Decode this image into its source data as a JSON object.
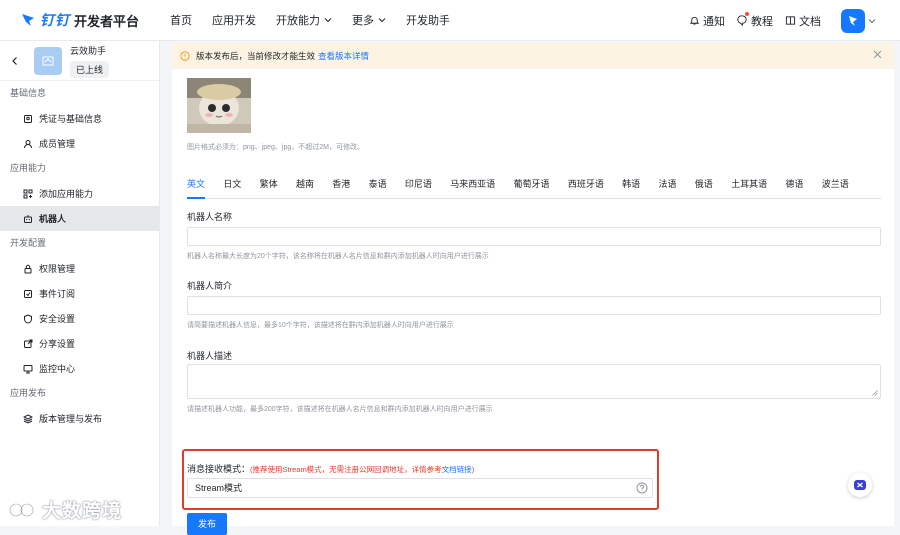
{
  "topbar": {
    "brand": "钉钉",
    "title": "开发者平台",
    "nav": [
      {
        "label": "首页",
        "has_menu": false
      },
      {
        "label": "应用开发",
        "has_menu": false
      },
      {
        "label": "开放能力",
        "has_menu": true
      },
      {
        "label": "更多",
        "has_menu": true
      },
      {
        "label": "开发助手",
        "has_menu": false
      }
    ],
    "notify": "通知",
    "tutorial": "教程",
    "docs": "文档"
  },
  "sidebar": {
    "app_name": "云效助手",
    "app_status": "已上线",
    "groups": [
      {
        "title": "基础信息",
        "items": [
          {
            "label": "凭证与基础信息",
            "icon": "credential-icon"
          },
          {
            "label": "成员管理",
            "icon": "member-icon"
          }
        ]
      },
      {
        "title": "应用能力",
        "items": [
          {
            "label": "添加应用能力",
            "icon": "add-capability-icon"
          },
          {
            "label": "机器人",
            "icon": "robot-icon",
            "active": true
          }
        ]
      },
      {
        "title": "开发配置",
        "items": [
          {
            "label": "权限管理",
            "icon": "lock-icon"
          },
          {
            "label": "事件订阅",
            "icon": "event-icon"
          },
          {
            "label": "安全设置",
            "icon": "shield-icon"
          },
          {
            "label": "分享设置",
            "icon": "share-icon"
          },
          {
            "label": "监控中心",
            "icon": "monitor-icon"
          }
        ]
      },
      {
        "title": "应用发布",
        "items": [
          {
            "label": "版本管理与发布",
            "icon": "layers-icon"
          }
        ]
      }
    ]
  },
  "banner": {
    "text": "版本发布后，当前修改才能生效",
    "link": "查看版本详情"
  },
  "form": {
    "image_hint": "图片格式必须为：png、jpeg、jpg，不超过2M，可修改。",
    "tabs": [
      "英文",
      "日文",
      "繁体",
      "越南",
      "香港",
      "泰语",
      "印尼语",
      "马来西亚语",
      "葡萄牙语",
      "西班牙语",
      "韩语",
      "法语",
      "俄语",
      "土耳其语",
      "德语",
      "波兰语"
    ],
    "active_tab": 0,
    "name_label": "机器人名称",
    "name_value": "",
    "name_hint": "机器人名称最大长度为20个字符，该名称将在机器人名片信息和群内添加机器人时向用户进行展示",
    "intro_label": "机器人简介",
    "intro_value": "",
    "intro_hint": "请简要描述机器人信息，最多10个字符，该描述将在群内添加机器人时向用户进行展示",
    "desc_label": "机器人描述",
    "desc_value": "",
    "desc_hint": "请描述机器人功能，最多200字符，该描述将在机器人名片信息和群内添加机器人时向用户进行展示",
    "mode_label": "消息接收模式：",
    "mode_note": "(推荐使用Stream模式，无需注册公网回调地址，详情参考",
    "mode_note_link": "文档链接",
    "mode_note_end": ")",
    "mode_value": "Stream模式",
    "publish_label": "发布"
  },
  "watermark": "大数跨境",
  "colors": {
    "accent": "#1677ff",
    "highlight": "#e23b2e",
    "banner_bg": "#fdf3e3"
  }
}
